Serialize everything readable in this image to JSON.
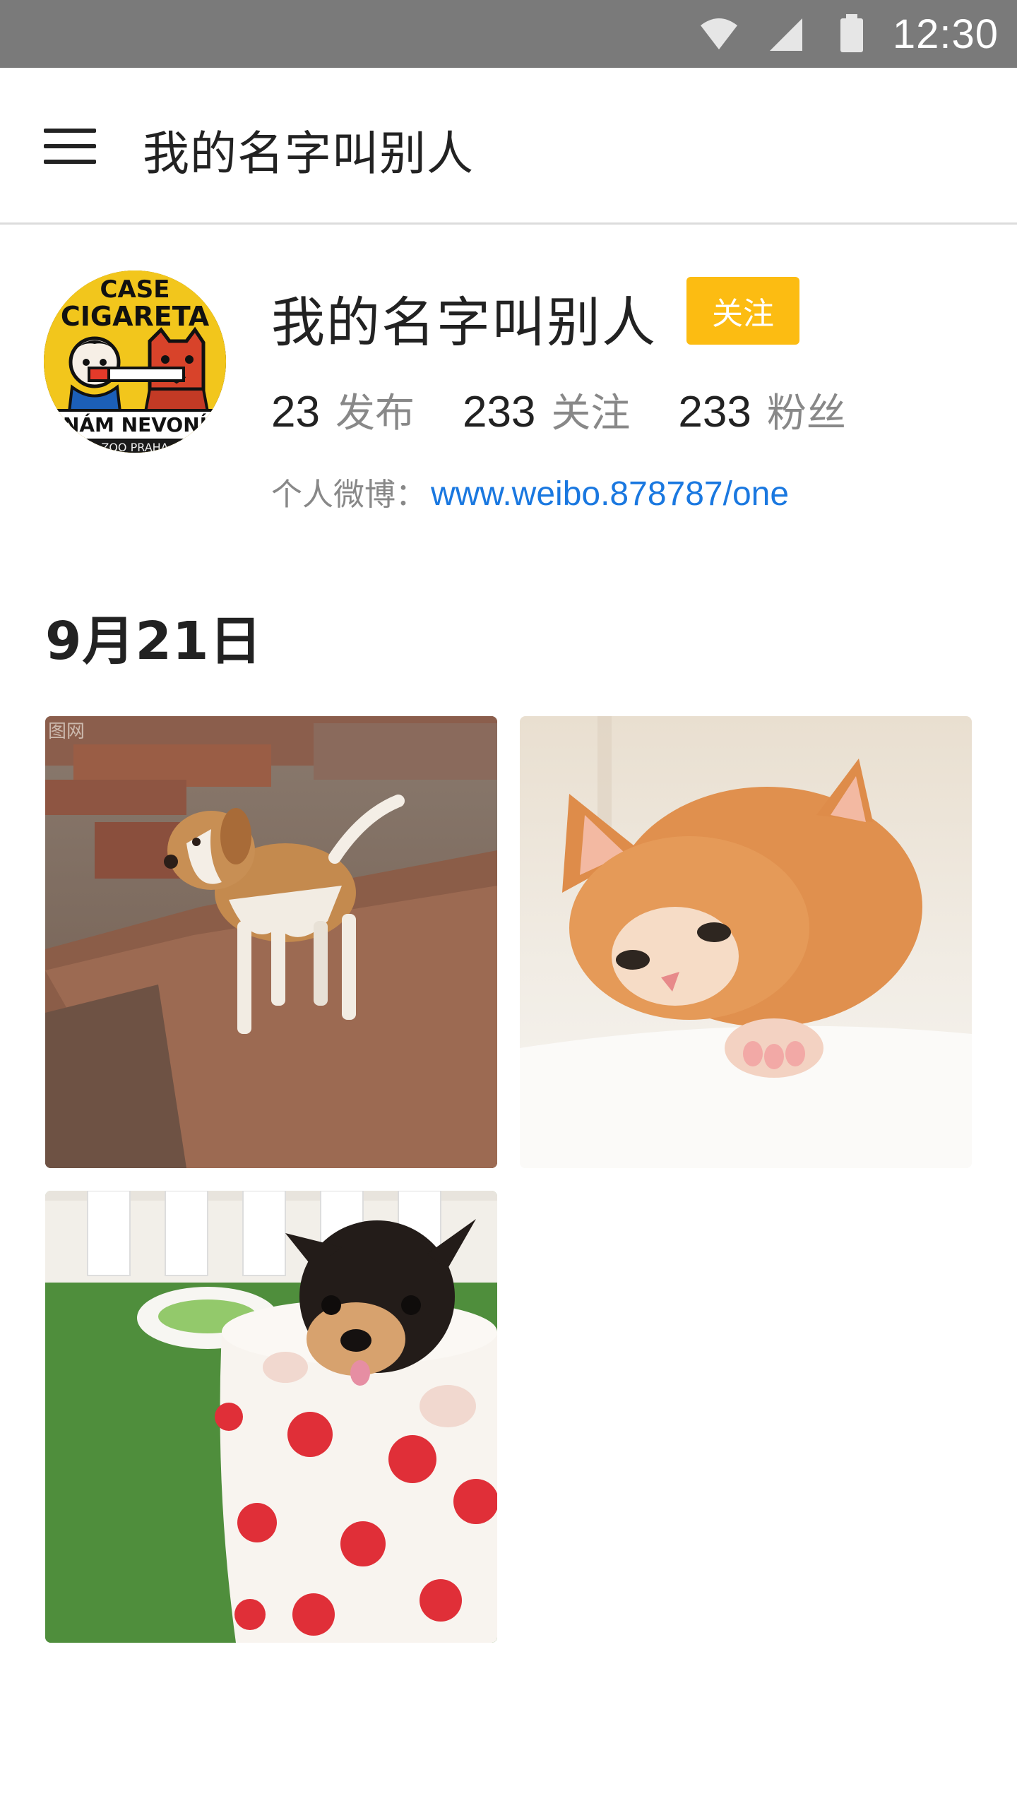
{
  "status_bar": {
    "time": "12:30",
    "icons": [
      "wifi-icon",
      "signal-icon",
      "battery-icon"
    ]
  },
  "app_bar": {
    "menu_icon": "hamburger-menu-icon",
    "title": "我的名字叫别人"
  },
  "profile": {
    "name": "我的名字叫别人",
    "follow_label": "关注",
    "follow_color": "#fcbc12",
    "avatar_text": {
      "top": "CASE",
      "middle": "CIGARETA",
      "bottom": "NÁM NEVONÍ",
      "footer": "ZOO PRAHA"
    },
    "stats": [
      {
        "count": "23",
        "label": "发布"
      },
      {
        "count": "233",
        "label": "关注"
      },
      {
        "count": "233",
        "label": "粉丝"
      }
    ],
    "blog_label": "个人微博：",
    "blog_url": "www.weibo.878787/one",
    "link_color": "#1a78e0"
  },
  "posts": {
    "date": "9月21日",
    "photos": [
      {
        "subject": "puppy-on-rocks-photo"
      },
      {
        "subject": "orange-kitten-photo"
      },
      {
        "subject": "puppy-in-polka-dot-cup-photo"
      }
    ],
    "watermark": "图网"
  }
}
